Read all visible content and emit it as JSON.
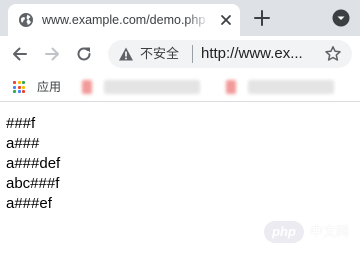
{
  "tab": {
    "title": "www.example.com/demo.php",
    "favicon": "globe-icon"
  },
  "toolbar": {
    "back": "arrow-left-icon",
    "forward": "arrow-right-icon",
    "reload": "reload-icon"
  },
  "omnibox": {
    "security_icon": "info-icon",
    "security_label": "不安全",
    "url": "http://www.ex..."
  },
  "bookmarks": {
    "apps_label": "应用",
    "apps_colors": [
      "#ea4335",
      "#fbbc05",
      "#34a853",
      "#4285f4",
      "#ea4335",
      "#fbbc05",
      "#34a853",
      "#4285f4",
      "#ea4335"
    ]
  },
  "content": {
    "lines": [
      "###f",
      "a###",
      "a###def",
      "abc###f",
      "a###ef"
    ]
  },
  "watermark": {
    "badge": "php",
    "text": "中文网"
  },
  "colors": {
    "tabstrip": "#dee1e6",
    "omnibox": "#f1f3f4",
    "icon": "#5f6368"
  }
}
